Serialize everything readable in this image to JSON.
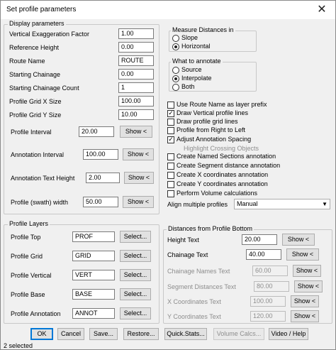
{
  "window": {
    "title": "Set profile parameters",
    "close_glyph": "✕"
  },
  "display": {
    "legend": "Display parameters",
    "vertical_exaggeration": {
      "label": "Vertical Exaggeration Factor",
      "value": "1.00"
    },
    "reference_height": {
      "label": "Reference Height",
      "value": "0.00"
    },
    "route_name": {
      "label": "Route Name",
      "value": "ROUTE"
    },
    "starting_chainage": {
      "label": "Starting Chainage",
      "value": "0.00"
    },
    "starting_chainage_count": {
      "label": "Starting Chainage Count",
      "value": "1"
    },
    "grid_x": {
      "label": "Profile Grid X Size",
      "value": "100.00"
    },
    "grid_y": {
      "label": "Profile Grid Y Size",
      "value": "10.00"
    },
    "profile_interval": {
      "label": "Profile Interval",
      "value": "20.00",
      "button": "Show <"
    },
    "annotation_interval": {
      "label": "Annotation Interval",
      "value": "100.00",
      "button": "Show <"
    },
    "annotation_text_height": {
      "label": "Annotation Text Height",
      "value": "2.00",
      "button": "Show <"
    },
    "swath_width": {
      "label": "Profile (swath) width",
      "value": "50.00",
      "button": "Show <"
    }
  },
  "measure": {
    "legend": "Measure Distances in",
    "options": [
      "Slope",
      "Horizontal"
    ],
    "selected": "Horizontal"
  },
  "annotate": {
    "legend": "What to annotate",
    "options": [
      "Source",
      "Interpolate",
      "Both"
    ],
    "selected": "Interpolate"
  },
  "options": [
    {
      "label": "Use Route Name as layer prefix",
      "checked": false,
      "disabled": false
    },
    {
      "label": "Draw Vertical profile lines",
      "checked": true,
      "disabled": false
    },
    {
      "label": "Draw profile grid lines",
      "checked": false,
      "disabled": false
    },
    {
      "label": "Profile from Right to Left",
      "checked": false,
      "disabled": false
    },
    {
      "label": "Adjust Annotation Spacing",
      "checked": true,
      "disabled": false
    },
    {
      "label": "Highlight Crossing Objects",
      "checked": false,
      "disabled": true
    },
    {
      "label": "Create Named Sections annotation",
      "checked": false,
      "disabled": false
    },
    {
      "label": "Create Segment distance annotation",
      "checked": false,
      "disabled": false
    },
    {
      "label": "Create X coordinates annotation",
      "checked": false,
      "disabled": false
    },
    {
      "label": "Create Y coordinates annotation",
      "checked": false,
      "disabled": false
    },
    {
      "label": "Perform Volume calculations",
      "checked": false,
      "disabled": false
    }
  ],
  "align": {
    "label": "Align multiple profiles",
    "value": "Manual"
  },
  "layers": {
    "legend": "Profile Layers",
    "select_label": "Select...",
    "rows": [
      {
        "label": "Profile Top",
        "value": "PROF"
      },
      {
        "label": "Profile Grid",
        "value": "GRID"
      },
      {
        "label": "Profile Vertical",
        "value": "VERT"
      },
      {
        "label": "Profile Base",
        "value": "BASE"
      },
      {
        "label": "Profile Annotation",
        "value": "ANNOT"
      }
    ]
  },
  "distances": {
    "legend": "Distances from Profile Bottom",
    "rows": [
      {
        "label": "Height Text",
        "value": "20.00",
        "button": "Show <",
        "disabled": false
      },
      {
        "label": "Chainage Text",
        "value": "40.00",
        "button": "Show <",
        "disabled": false
      },
      {
        "label": "Chainage Names Text",
        "value": "60.00",
        "button": "Show <",
        "disabled": true
      },
      {
        "label": "Segment Distances Text",
        "value": "80.00",
        "button": "Show <",
        "disabled": true
      },
      {
        "label": "X Coordinates Text",
        "value": "100.00",
        "button": "Show <",
        "disabled": true
      },
      {
        "label": "Y Coordinates Text",
        "value": "120.00",
        "button": "Show <",
        "disabled": true
      }
    ]
  },
  "buttons": {
    "ok": "OK",
    "cancel": "Cancel",
    "save": "Save...",
    "restore": "Restore...",
    "quickstats": "Quick.Stats...",
    "volume": "Volume Calcs...",
    "video": "Video / Help"
  },
  "status": "2 selected"
}
